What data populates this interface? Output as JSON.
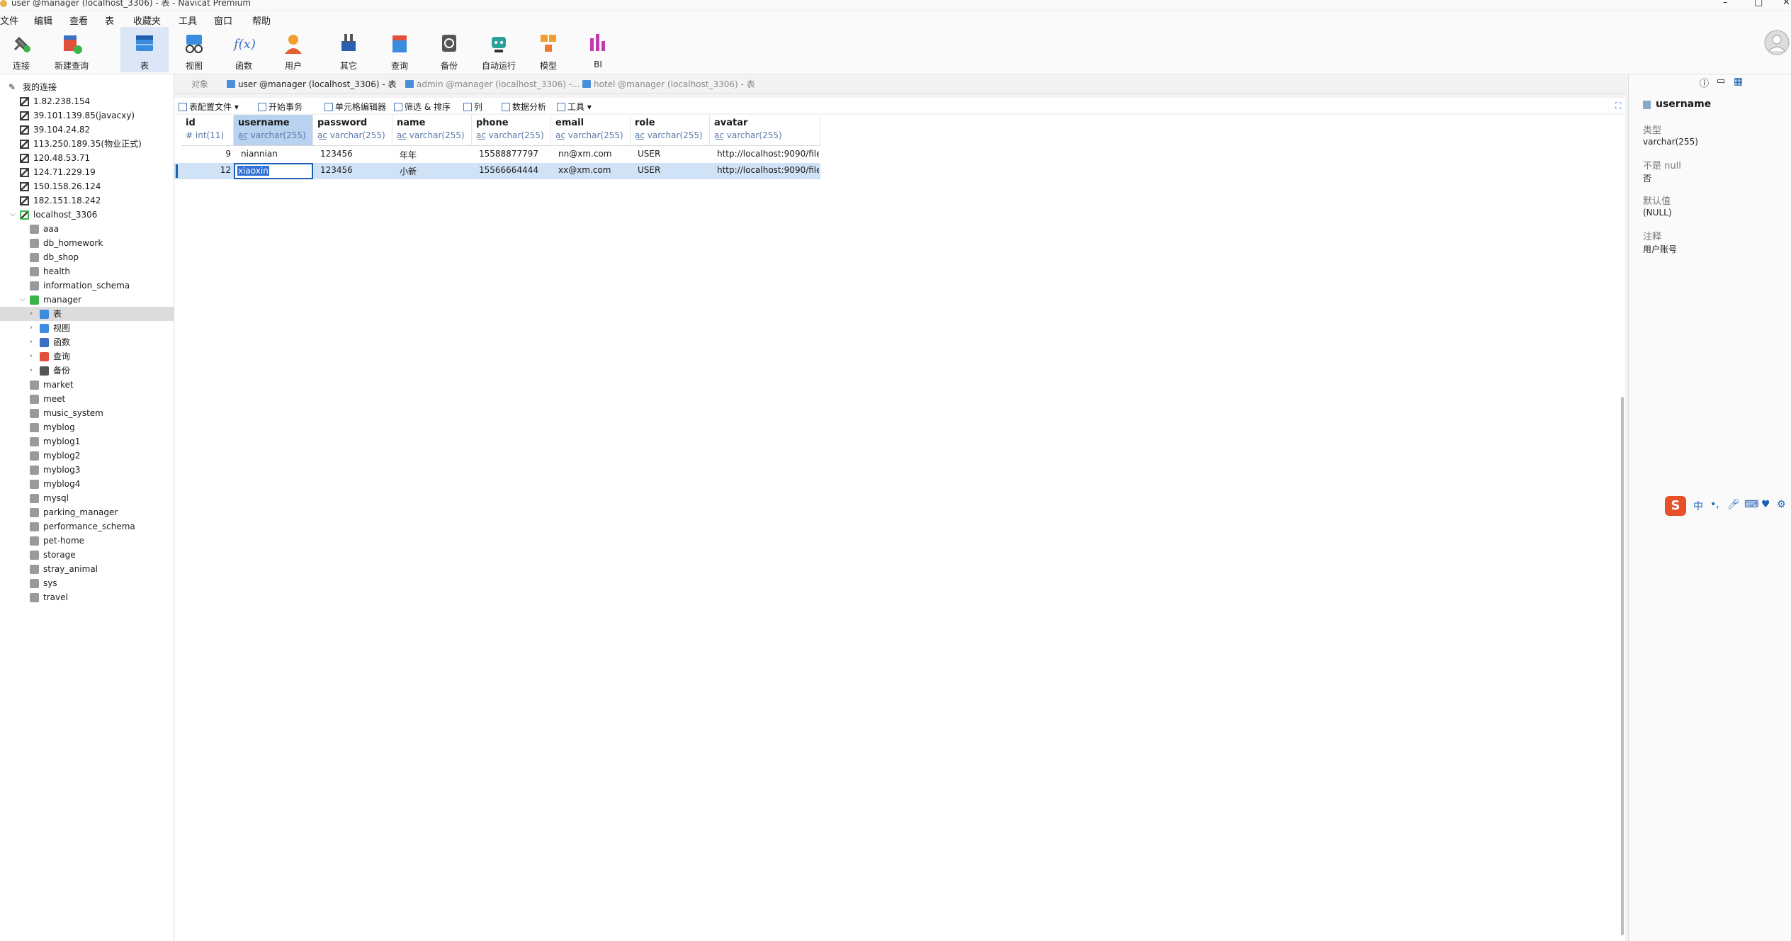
{
  "window": {
    "title": "user @manager (localhost_3306) - 表 - Navicat Premium"
  },
  "menu": [
    "文件",
    "编辑",
    "查看",
    "表",
    "收藏夹",
    "工具",
    "窗口",
    "帮助"
  ],
  "toolbar": [
    {
      "label": "连接"
    },
    {
      "label": "新建查询"
    },
    {
      "label": "表"
    },
    {
      "label": "视图"
    },
    {
      "label": "函数"
    },
    {
      "label": "用户"
    },
    {
      "label": "其它"
    },
    {
      "label": "查询"
    },
    {
      "label": "备份"
    },
    {
      "label": "自动运行"
    },
    {
      "label": "模型"
    },
    {
      "label": "BI"
    }
  ],
  "colors": {
    "accent": "#1a5fb4",
    "selected_row": "#cfe2f6",
    "active_tool": "#dbe7f6"
  },
  "sidebar": {
    "header": "我的连接",
    "servers": [
      "1.82.238.154",
      "39.101.139.85(javacxy)",
      "39.104.24.82",
      "113.250.189.35(物业正式)",
      "120.48.53.71",
      "124.71.229.19",
      "150.158.26.124",
      "182.151.18.242"
    ],
    "local": "localhost_3306",
    "dbs_before": [
      "aaa",
      "db_homework",
      "db_shop",
      "health",
      "information_schema"
    ],
    "manager": "manager",
    "manager_children": [
      "表",
      "视图",
      "函数",
      "查询",
      "备份"
    ],
    "dbs_after": [
      "market",
      "meet",
      "music_system",
      "myblog",
      "myblog1",
      "myblog2",
      "myblog3",
      "myblog4",
      "mysql",
      "parking_manager",
      "performance_schema",
      "pet-home",
      "storage",
      "stray_animal",
      "sys",
      "travel"
    ]
  },
  "tabs": [
    {
      "label": "对象"
    },
    {
      "label": "user @manager (localhost_3306) - 表"
    },
    {
      "label": "admin @manager (localhost_3306) -..."
    },
    {
      "label": "hotel @manager (localhost_3306) - 表"
    }
  ],
  "subtoolbar": [
    "表配置文件",
    "开始事务",
    "单元格编辑器",
    "筛选 & 排序",
    "列",
    "数据分析",
    "工具"
  ],
  "table": {
    "columns": [
      {
        "name": "id",
        "type": "int(11)"
      },
      {
        "name": "username",
        "type": "varchar(255)"
      },
      {
        "name": "password",
        "type": "varchar(255)"
      },
      {
        "name": "name",
        "type": "varchar(255)"
      },
      {
        "name": "phone",
        "type": "varchar(255)"
      },
      {
        "name": "email",
        "type": "varchar(255)"
      },
      {
        "name": "role",
        "type": "varchar(255)"
      },
      {
        "name": "avatar",
        "type": "varchar(255)"
      }
    ],
    "rows": [
      [
        "9",
        "niannian",
        "123456",
        "年年",
        "15588877797",
        "nn@xm.com",
        "USER",
        "http://localhost:9090/file"
      ],
      [
        "12",
        "xiaoxin",
        "123456",
        "小新",
        "15566664444",
        "xx@xm.com",
        "USER",
        "http://localhost:9090/file"
      ]
    ]
  },
  "field_info": {
    "name": "username",
    "type_label": "类型",
    "type_value": "varchar(255)",
    "notnull_label": "不是 null",
    "notnull_value": "否",
    "default_label": "默认值",
    "default_value": "(NULL)",
    "comment_label": "注释",
    "comment_value": "用户账号"
  },
  "ime": {
    "label": "中"
  }
}
